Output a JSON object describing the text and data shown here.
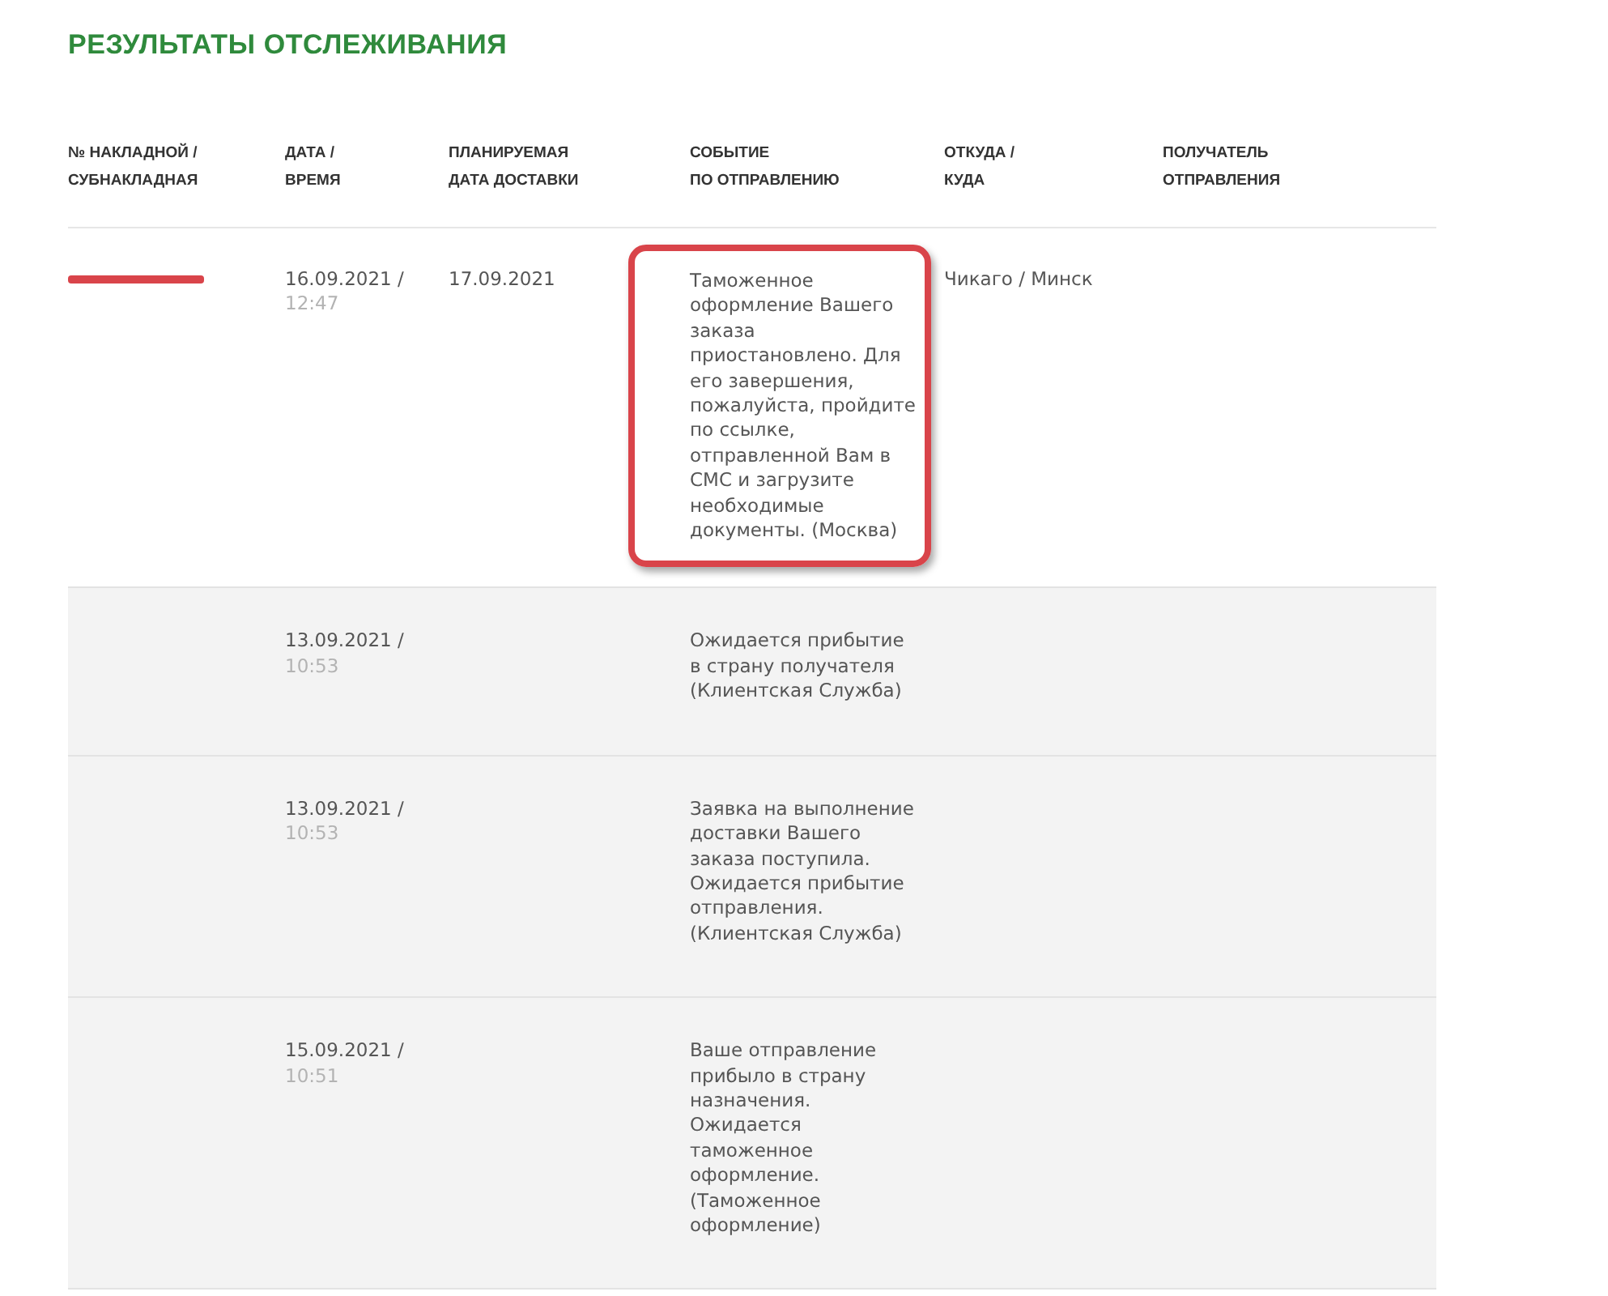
{
  "title": "РЕЗУЛЬТАТЫ ОТСЛЕЖИВАНИЯ",
  "columns": [
    {
      "lines": [
        "№ НАКЛАДНОЙ /",
        "СУБНАКЛАДНАЯ"
      ]
    },
    {
      "lines": [
        "ДАТА /",
        "ВРЕМЯ"
      ]
    },
    {
      "lines": [
        "ПЛАНИРУЕМАЯ",
        "ДАТА ДОСТАВКИ"
      ]
    },
    {
      "lines": [
        "СОБЫТИЕ",
        "ПО ОТПРАВЛЕНИЮ"
      ]
    },
    {
      "lines": [
        "ОТКУДА /",
        "КУДА"
      ]
    },
    {
      "lines": [
        "ПОЛУЧАТЕЛЬ",
        "ОТПРАВЛЕНИЯ"
      ]
    }
  ],
  "rows": [
    {
      "waybill_redacted": true,
      "date": "16.09.2021 /",
      "time": "12:47",
      "planned": "17.09.2021",
      "event": "Таможенное оформление Вашего заказа приостановлено. Для его завершения, пожалуйста, пройдите по ссылке, отправленной Вам в СМС и загрузите необходимые документы. (Москва)",
      "highlighted": true,
      "route": "Чикаго / Минск",
      "shaded": false
    },
    {
      "date": "13.09.2021 /",
      "time": "10:53",
      "event": "Ожидается прибытие в страну получателя (Клиентская Служба)",
      "highlighted": false,
      "shaded": true
    },
    {
      "date": "13.09.2021 /",
      "time": "10:53",
      "event": "Заявка на выполнение доставки Вашего заказа поступила. Ожидается прибытие отправления. (Клиентская Служба)",
      "highlighted": false,
      "shaded": true
    },
    {
      "date": "15.09.2021 /",
      "time": "10:51",
      "event": "Ваше отправление прибыло в страну назначения. Ожидается таможенное оформление. (Таможенное оформление)",
      "highlighted": false,
      "shaded": true
    }
  ]
}
